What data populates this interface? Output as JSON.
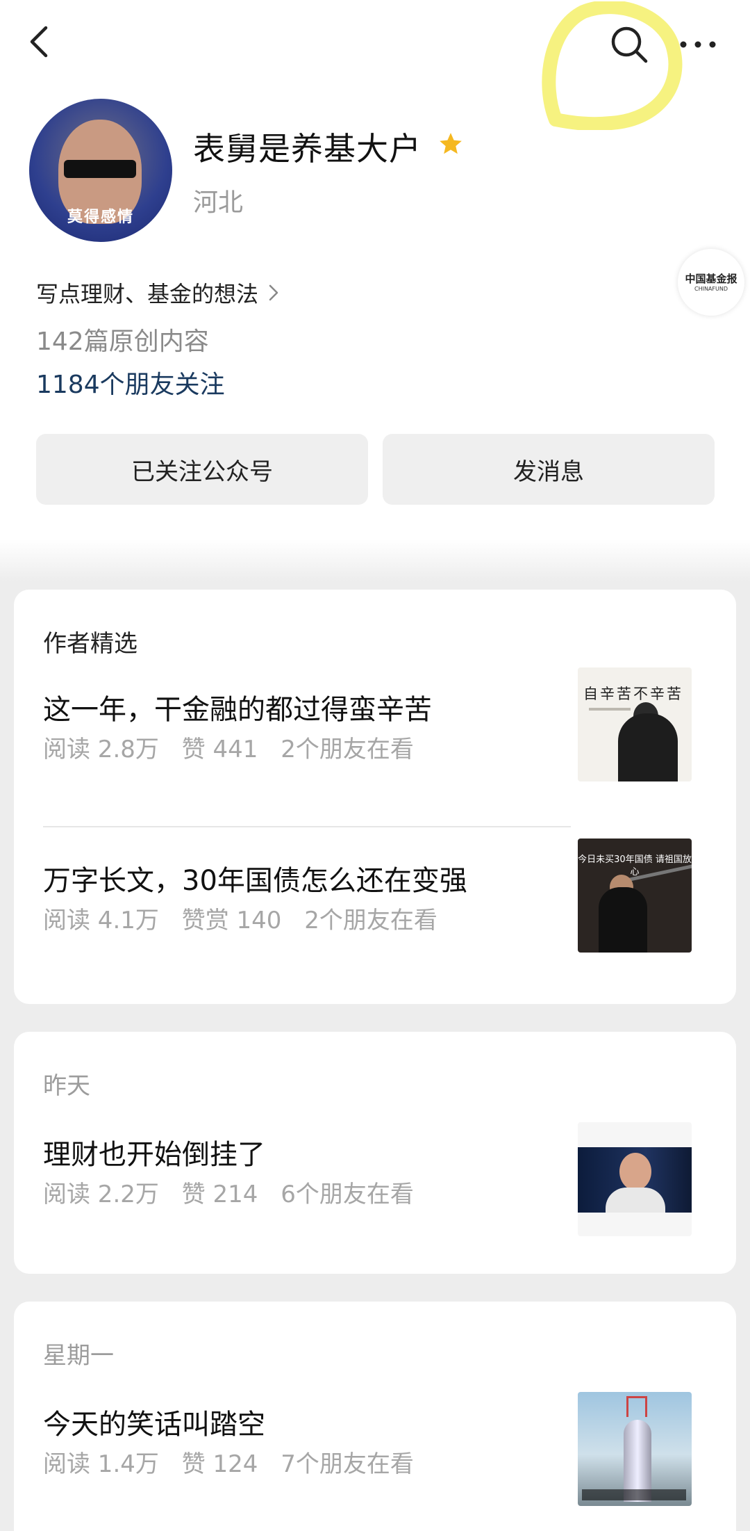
{
  "profile": {
    "name": "表舅是养基大户",
    "location": "河北",
    "avatar_caption": "莫得感情",
    "intro": "写点理财、基金的想法",
    "articles_count": "142篇原创内容",
    "followers": "1184个朋友关注"
  },
  "brand_badge": {
    "line1": "中国基金报",
    "line2": "CHINAFUND"
  },
  "buttons": {
    "follow": "已关注公众号",
    "message": "发消息"
  },
  "featured": {
    "title": "作者精选",
    "articles": [
      {
        "title": "这一年，干金融的都过得蛮辛苦",
        "reads": "阅读 2.8万",
        "likes": "赞 441",
        "friends": "2个朋友在看",
        "thumb_text": "自辛苦不辛苦"
      },
      {
        "title": "万字长文，30年国债怎么还在变强",
        "reads": "阅读 4.1万",
        "likes": "赞赏 140",
        "friends": "2个朋友在看",
        "thumb_text": "今日未买30年国债 请祖国放心"
      }
    ]
  },
  "yesterday": {
    "title": "昨天",
    "article": {
      "title": "理财也开始倒挂了",
      "reads": "阅读 2.2万",
      "likes": "赞 214",
      "friends": "6个朋友在看"
    }
  },
  "monday": {
    "title": "星期一",
    "article": {
      "title": "今天的笑话叫踏空",
      "reads": "阅读 1.4万",
      "likes": "赞 124",
      "friends": "7个朋友在看"
    }
  },
  "icons": {
    "back": "chevron-left-icon",
    "search": "search-icon",
    "more": "more-dots-icon",
    "star": "star-icon",
    "chevron": "chevron-right-icon"
  },
  "colors": {
    "star": "#f5b820",
    "highlight": "#f4f06a",
    "followers_text": "#1a3a5f",
    "muted_text": "#a6a6a6",
    "feed_background": "#ededed"
  }
}
